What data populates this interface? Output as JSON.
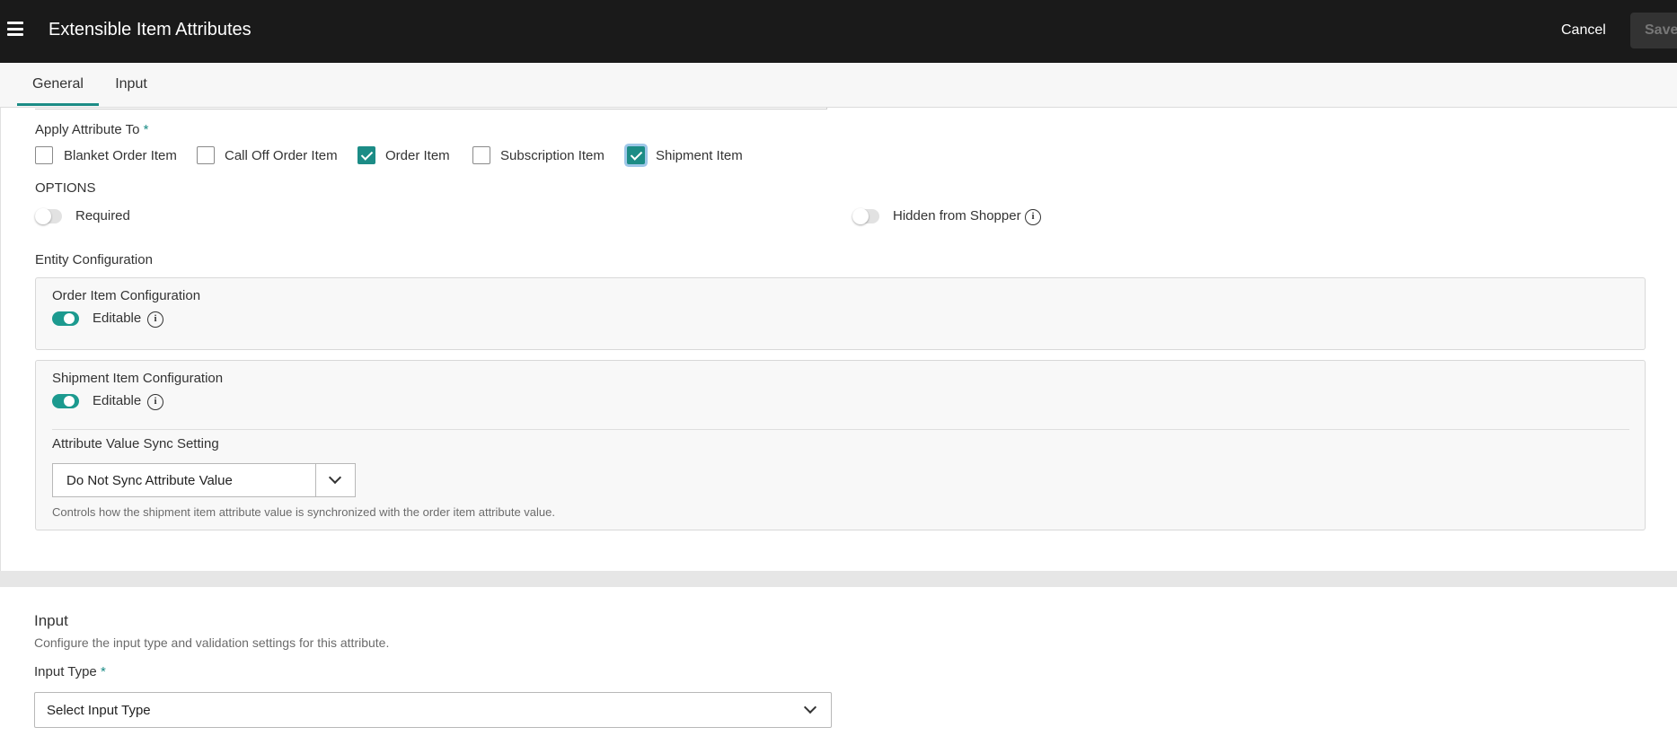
{
  "header": {
    "title": "Extensible Item Attributes",
    "cancel_label": "Cancel",
    "save_label": "Save"
  },
  "tabs": [
    {
      "label": "General",
      "active": true
    },
    {
      "label": "Input",
      "active": false
    }
  ],
  "apply_to": {
    "label": "Apply Attribute To",
    "required_mark": "*",
    "options": [
      {
        "label": "Blanket Order Item",
        "checked": false
      },
      {
        "label": "Call Off Order Item",
        "checked": false
      },
      {
        "label": "Order Item",
        "checked": true
      },
      {
        "label": "Subscription Item",
        "checked": false
      },
      {
        "label": "Shipment Item",
        "checked": true
      }
    ]
  },
  "options": {
    "heading": "OPTIONS",
    "required_label": "Required",
    "required_on": false,
    "hidden_label": "Hidden from Shopper",
    "hidden_on": false
  },
  "entity_config": {
    "heading": "Entity Configuration",
    "order_item": {
      "title": "Order Item Configuration",
      "editable_label": "Editable",
      "editable_on": true
    },
    "shipment_item": {
      "title": "Shipment Item Configuration",
      "editable_label": "Editable",
      "editable_on": true,
      "sync_label": "Attribute Value Sync Setting",
      "sync_value": "Do Not Sync Attribute Value",
      "sync_helper": "Controls how the shipment item attribute value is synchronized with the order item attribute value."
    }
  },
  "input_section": {
    "title": "Input",
    "description": "Configure the input type and validation settings for this attribute.",
    "input_type_label": "Input Type",
    "required_mark": "*",
    "input_type_placeholder": "Select Input Type"
  },
  "colors": {
    "accent": "#1c8c86",
    "topbar": "#1a1a1a"
  }
}
